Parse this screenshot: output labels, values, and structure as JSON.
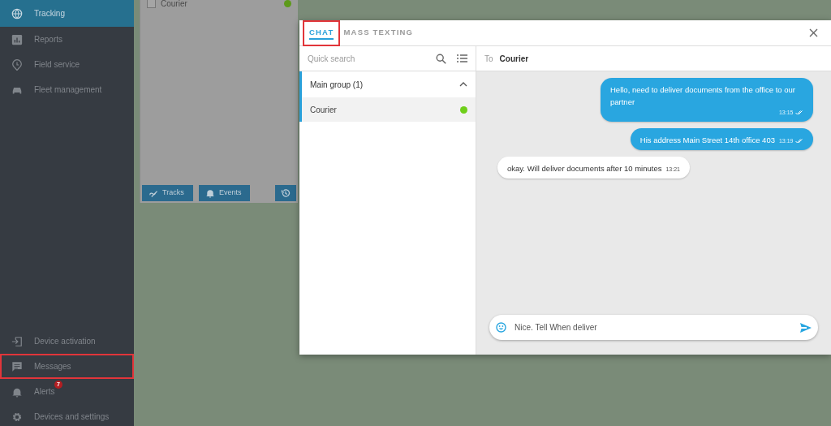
{
  "sidebar": {
    "top_items": [
      {
        "label": "Tracking",
        "selected": true,
        "highlighted": false
      },
      {
        "label": "Reports",
        "selected": false,
        "highlighted": false
      },
      {
        "label": "Field service",
        "selected": false,
        "highlighted": false
      },
      {
        "label": "Fleet management",
        "selected": false,
        "highlighted": false
      }
    ],
    "bottom_items": [
      {
        "label": "Device activation",
        "selected": false,
        "highlighted": false
      },
      {
        "label": "Messages",
        "selected": false,
        "highlighted": true
      },
      {
        "label": "Alerts",
        "selected": false,
        "highlighted": false,
        "badge": "7"
      },
      {
        "label": "Devices and settings",
        "selected": false,
        "highlighted": false
      }
    ]
  },
  "tracking_panel": {
    "rows": [
      {
        "label": "Courier",
        "checked": false,
        "online": true
      }
    ],
    "buttons": [
      {
        "kind": "text",
        "label": "Tracks"
      },
      {
        "kind": "text",
        "label": "Events"
      },
      {
        "kind": "icon"
      }
    ]
  },
  "chat_window": {
    "tabs": [
      {
        "label": "CHAT",
        "selected": true,
        "highlighted": true
      },
      {
        "label": "MASS TEXTING",
        "selected": false,
        "highlighted": false
      }
    ],
    "search": {
      "placeholder": "Quick search"
    },
    "groups": [
      {
        "label": "Main group (1)",
        "expanded": true,
        "children": [
          {
            "label": "Courier",
            "selected": true,
            "online": true
          }
        ]
      }
    ],
    "recipient": {
      "prefix": "To",
      "name": "Courier"
    },
    "messages": [
      {
        "text": "Hello, need to deliver documents from the office to our partner",
        "time": "13:15",
        "outgoing": true,
        "read": true
      },
      {
        "text": "His address Main Street 14th office 403",
        "time": "13:19",
        "outgoing": true,
        "read": true
      },
      {
        "text": "okay. Will deliver documents after 10 minutes",
        "time": "13:21",
        "outgoing": false,
        "read": false
      }
    ],
    "composer": {
      "value": "Nice. Tell When deliver"
    }
  }
}
